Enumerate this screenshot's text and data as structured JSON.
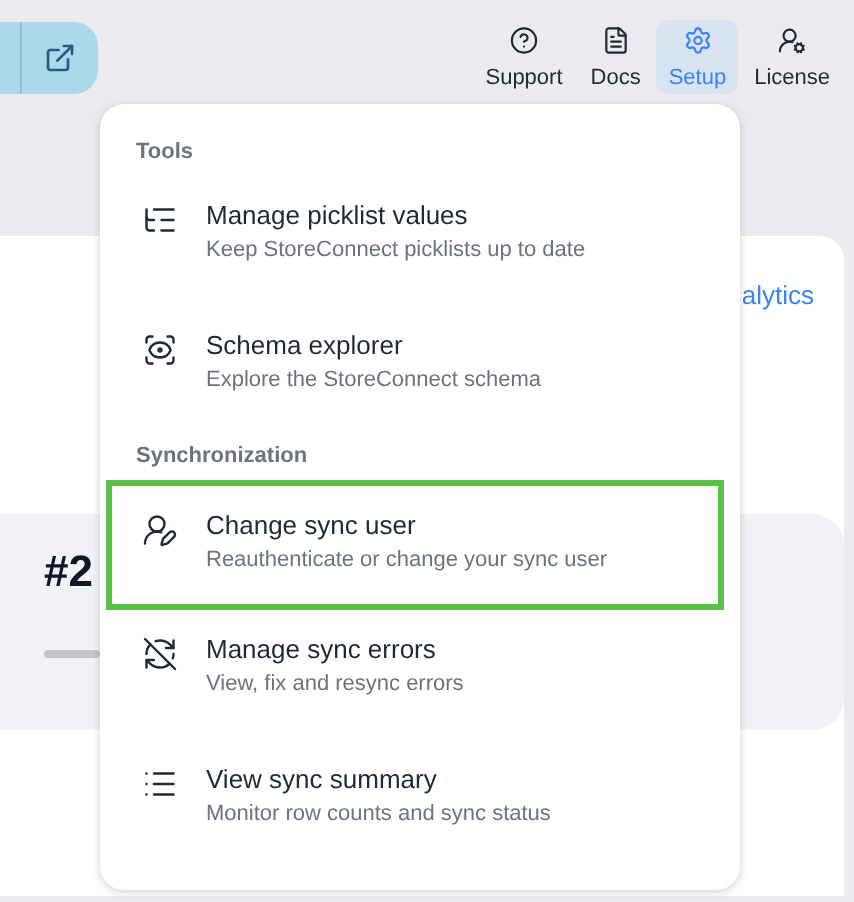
{
  "nav": [
    {
      "label": "Support",
      "kind": "support",
      "selected": false
    },
    {
      "label": "Docs",
      "kind": "docs",
      "selected": false
    },
    {
      "label": "Setup",
      "kind": "setup",
      "selected": true
    },
    {
      "label": "License",
      "kind": "license",
      "selected": false
    }
  ],
  "background": {
    "link": "alytics",
    "heading": "#2"
  },
  "menu": {
    "sections": [
      {
        "title": "Tools",
        "items": [
          {
            "kind": "picklist",
            "title": "Manage picklist values",
            "subtitle": "Keep StoreConnect picklists up to date",
            "selected": false
          },
          {
            "kind": "schema",
            "title": "Schema explorer",
            "subtitle": "Explore the StoreConnect schema",
            "selected": false
          }
        ]
      },
      {
        "title": "Synchronization",
        "items": [
          {
            "kind": "user",
            "title": "Change sync user",
            "subtitle": "Reauthenticate or change your sync user",
            "selected": true
          },
          {
            "kind": "errors",
            "title": "Manage sync errors",
            "subtitle": "View, fix and resync errors",
            "selected": false
          },
          {
            "kind": "summary",
            "title": "View sync summary",
            "subtitle": "Monitor row counts and sync status",
            "selected": false
          }
        ]
      }
    ]
  }
}
